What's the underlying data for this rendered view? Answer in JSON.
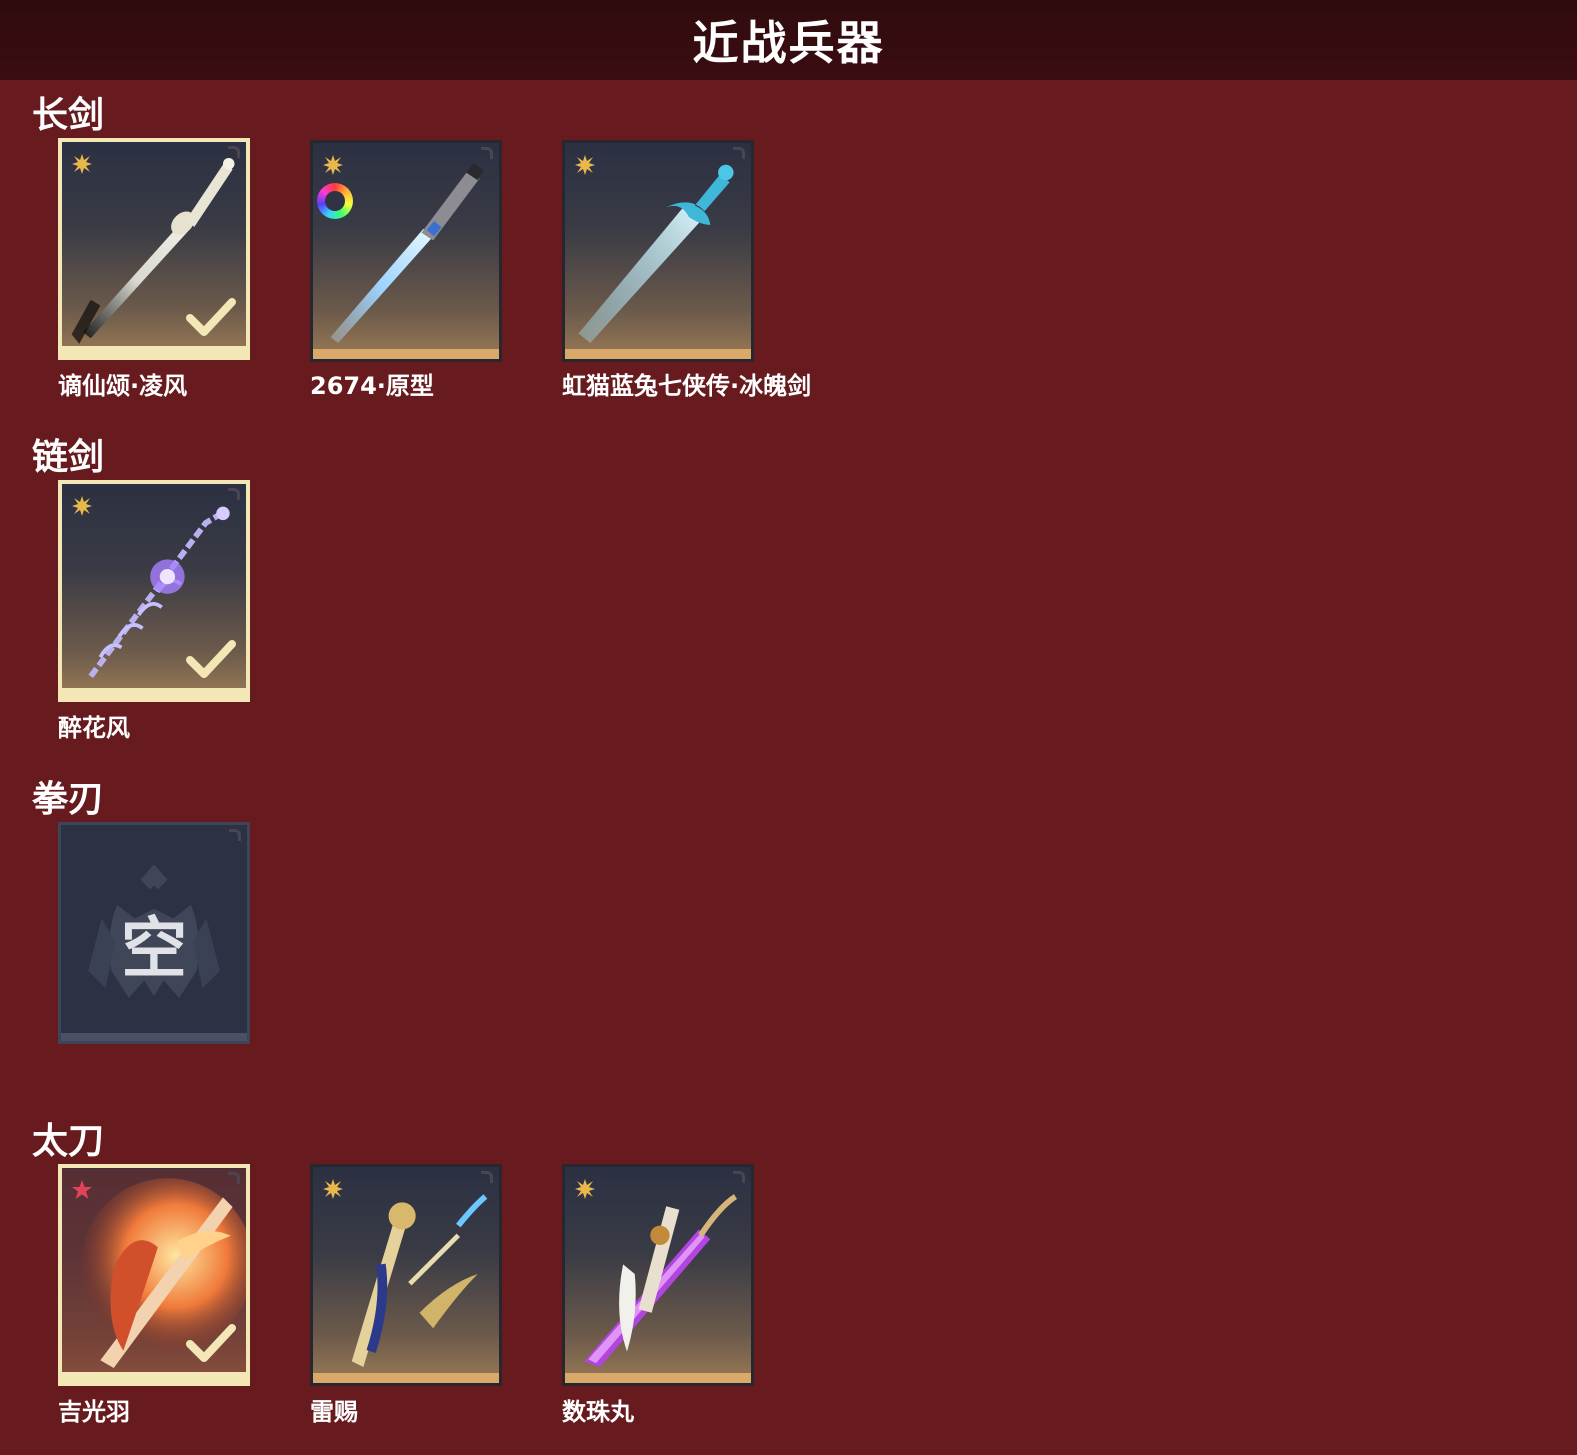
{
  "header": {
    "title": "近战兵器"
  },
  "sections": [
    {
      "title": "长剑",
      "items": [
        {
          "name": "谪仙颂·凌风",
          "selected": true,
          "rarity": "gold",
          "weapon_icon": "sword-icon"
        },
        {
          "name": "2674·原型",
          "selected": false,
          "rarity": "gold",
          "weapon_icon": "lightsaber-icon",
          "color_ring": true
        },
        {
          "name": "虹猫蓝兔七侠传·冰魄剑",
          "selected": false,
          "rarity": "gold",
          "weapon_icon": "ice-sword-icon"
        }
      ]
    },
    {
      "title": "链剑",
      "items": [
        {
          "name": "醉花风",
          "selected": true,
          "rarity": "gold",
          "weapon_icon": "chain-sword-icon"
        }
      ]
    },
    {
      "title": "拳刃",
      "items": [
        {
          "empty_label": "空",
          "empty": true
        }
      ]
    },
    {
      "title": "太刀",
      "items": [
        {
          "name": "吉光羽",
          "selected": true,
          "rarity": "red",
          "weapon_icon": "flame-katana-icon"
        },
        {
          "name": "雷赐",
          "selected": false,
          "rarity": "gold",
          "weapon_icon": "dragon-katana-icon"
        },
        {
          "name": "数珠丸",
          "selected": false,
          "rarity": "gold",
          "weapon_icon": "purple-katana-icon"
        }
      ]
    }
  ],
  "colors": {
    "background": "#671b1f",
    "header": "#2f0b0e",
    "gold_rarity": "#e8b84a",
    "red_rarity": "#e0445a",
    "selected_border": "#f4e7b6"
  }
}
